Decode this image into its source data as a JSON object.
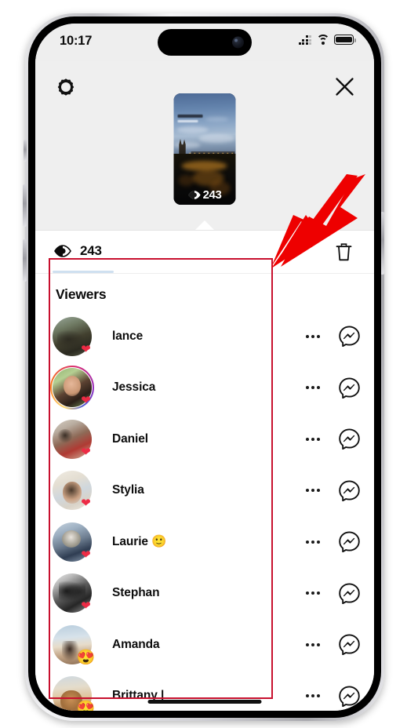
{
  "status_bar": {
    "time": "10:17",
    "signal_icon": "cellular-signal-icon",
    "wifi_icon": "wifi-icon",
    "battery_icon": "battery-full-icon"
  },
  "story_header": {
    "settings_icon": "gear-icon",
    "close_icon": "close-icon",
    "thumbnail": {
      "alt": "story-thumbnail-night-cityscape-bridge",
      "views_icon": "eye-icon",
      "views_count": "243"
    }
  },
  "views_bar": {
    "views_icon": "eye-icon",
    "views_count": "243",
    "delete_icon": "trash-icon"
  },
  "viewers": {
    "title": "Viewers",
    "rows": [
      {
        "name": "lance",
        "badge": "❤",
        "badge_type": "heart",
        "has_story_ring": false,
        "avatar_class": "a-lance",
        "more_icon": "more-options-icon",
        "message_icon": "messenger-icon"
      },
      {
        "name": "Jessica",
        "badge": "❤",
        "badge_type": "heart",
        "has_story_ring": true,
        "avatar_class": "a-jessica",
        "more_icon": "more-options-icon",
        "message_icon": "messenger-icon"
      },
      {
        "name": "Daniel",
        "badge": "❤",
        "badge_type": "heart",
        "has_story_ring": false,
        "avatar_class": "a-daniel",
        "more_icon": "more-options-icon",
        "message_icon": "messenger-icon"
      },
      {
        "name": "Stylia",
        "badge": "❤",
        "badge_type": "heart",
        "has_story_ring": false,
        "avatar_class": "a-stylia",
        "more_icon": "more-options-icon",
        "message_icon": "messenger-icon"
      },
      {
        "name": "Laurie 🙂",
        "badge": "❤",
        "badge_type": "heart",
        "has_story_ring": false,
        "avatar_class": "a-laurie",
        "more_icon": "more-options-icon",
        "message_icon": "messenger-icon"
      },
      {
        "name": "Stephan",
        "badge": "❤",
        "badge_type": "heart",
        "has_story_ring": false,
        "avatar_class": "a-stephan",
        "more_icon": "more-options-icon",
        "message_icon": "messenger-icon"
      },
      {
        "name": "Amanda",
        "badge": "😍",
        "badge_type": "heart-eyes",
        "has_story_ring": false,
        "avatar_class": "a-amanda",
        "more_icon": "more-options-icon",
        "message_icon": "messenger-icon"
      },
      {
        "name": "Brittany |",
        "badge": "😍",
        "badge_type": "heart-eyes",
        "has_story_ring": false,
        "avatar_class": "a-brittany",
        "more_icon": "more-options-icon",
        "message_icon": "messenger-icon"
      }
    ]
  },
  "annotations": {
    "highlight_box_color": "#c8102e",
    "arrow_color": "#ee0000"
  }
}
